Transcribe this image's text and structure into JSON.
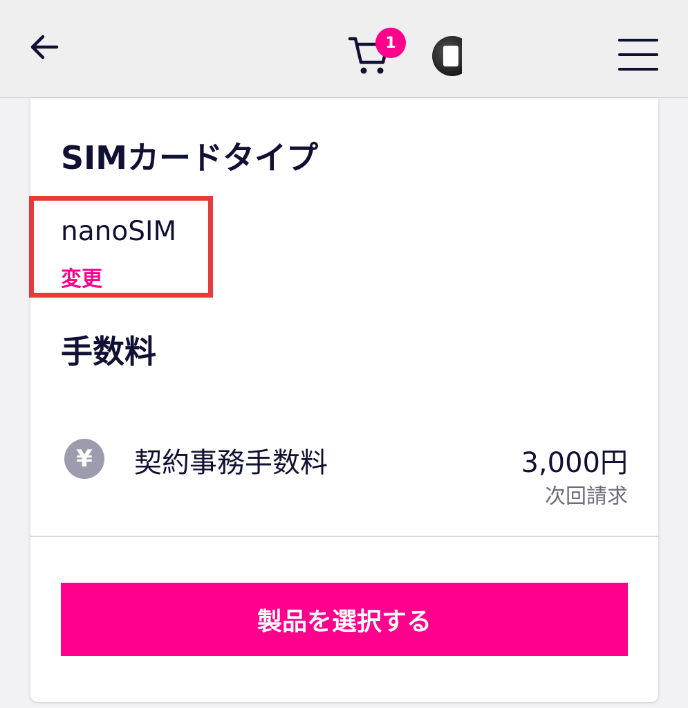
{
  "header": {
    "back_icon": "arrow-left-icon",
    "cart_icon": "cart-icon",
    "cart_count": "1",
    "menu_icon": "hamburger-menu-icon",
    "colors": {
      "badge": "#ff008c",
      "background": "#efefef"
    }
  },
  "sim_section": {
    "title": "SIMカードタイプ",
    "value": "nanoSIM",
    "change_label": "変更"
  },
  "fee_section": {
    "title": "手数料",
    "items": [
      {
        "icon": "yen-icon",
        "icon_glyph": "¥",
        "name": "契約事務手数料",
        "amount": "3,000円",
        "note": "次回請求"
      }
    ]
  },
  "actions": {
    "select_product_label": "製品を選択する"
  },
  "colors": {
    "accent": "#ff008c",
    "text": "#0f1033",
    "highlight": "#e83a3a"
  }
}
